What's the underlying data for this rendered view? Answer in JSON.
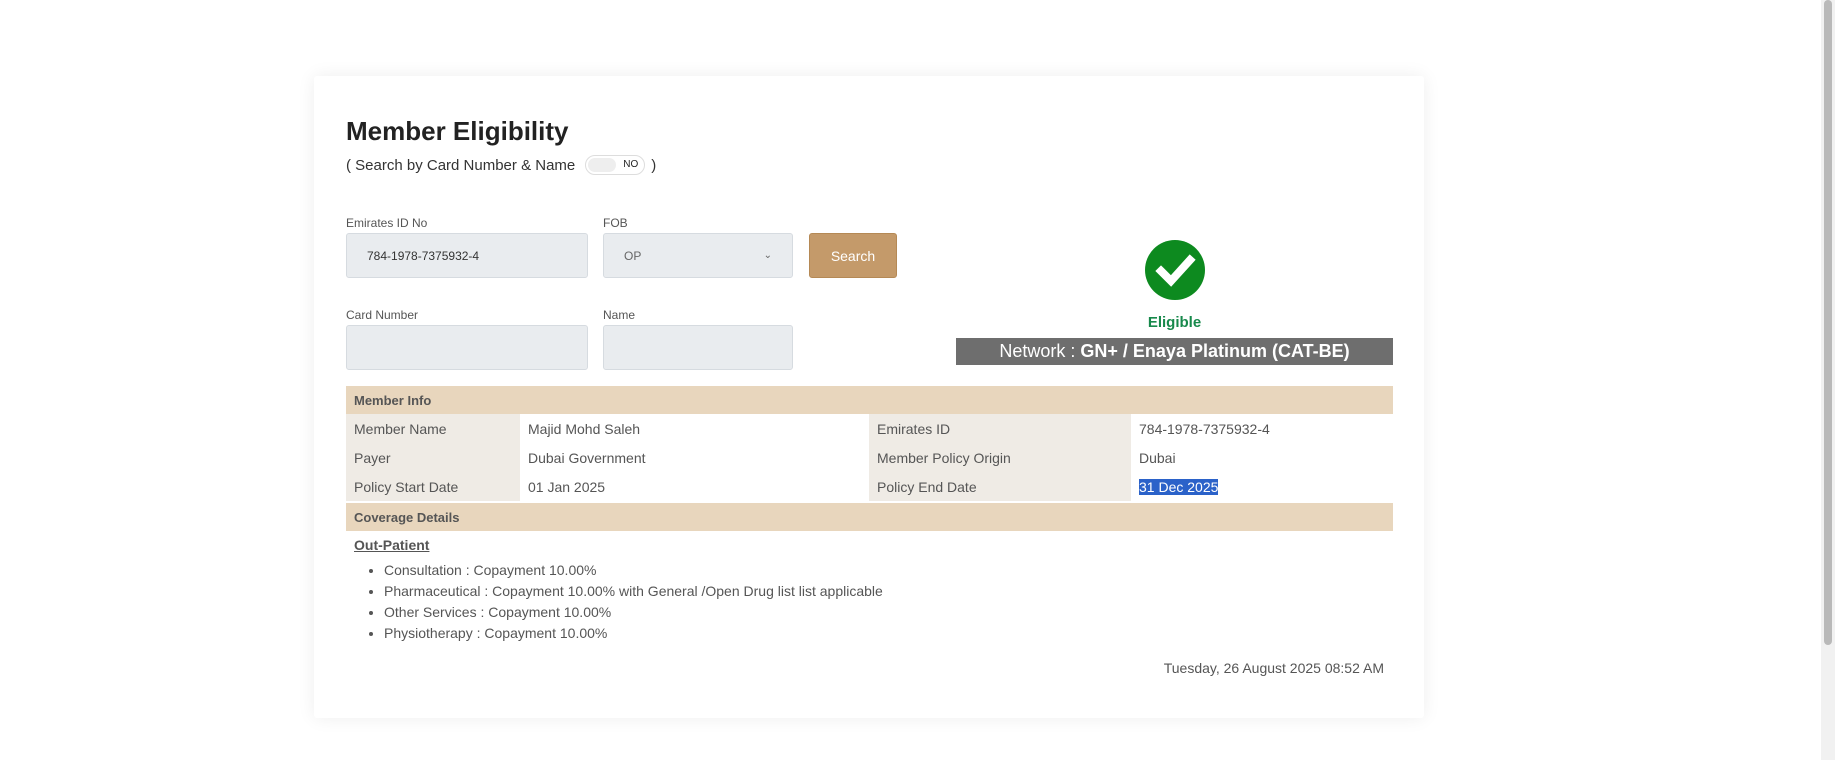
{
  "page": {
    "title": "Member Eligibility",
    "search_mode_prefix": "( Search by Card Number & Name",
    "search_mode_suffix": ")",
    "toggle_state": "NO"
  },
  "form": {
    "emirates_id": {
      "label": "Emirates ID No",
      "value": "784-1978-7375932-4"
    },
    "fob": {
      "label": "FOB",
      "selected": "OP"
    },
    "card_number": {
      "label": "Card Number",
      "value": ""
    },
    "name": {
      "label": "Name",
      "value": ""
    },
    "search_label": "Search"
  },
  "status": {
    "label": "Eligible",
    "network_prefix": "Network :",
    "network_value": "GN+ / Enaya Platinum (CAT-BE)"
  },
  "member_info": {
    "header": "Member Info",
    "rows": [
      {
        "l1": "Member Name",
        "v1": "Majid Mohd Saleh",
        "l2": "Emirates ID",
        "v2": "784-1978-7375932-4"
      },
      {
        "l1": "Payer",
        "v1": "Dubai Government",
        "l2": "Member Policy Origin",
        "v2": "Dubai"
      },
      {
        "l1": "Policy Start Date",
        "v1": "01 Jan 2025",
        "l2": "Policy End Date",
        "v2": "31 Dec 2025"
      }
    ]
  },
  "coverage": {
    "header": "Coverage Details",
    "section_title": "Out-Patient",
    "items": [
      "Consultation : Copayment 10.00%",
      "Pharmaceutical : Copayment 10.00% with General /Open Drug list list applicable",
      "Other Services : Copayment 10.00%",
      "Physiotherapy : Copayment 10.00%"
    ]
  },
  "footer": {
    "timestamp": "Tuesday, 26 August 2025 08:52 AM"
  },
  "colors": {
    "accent": "#c49a6a",
    "eligible": "#17894b",
    "section_header": "#e8d6bd",
    "network_bar": "#6e6e6e",
    "selection": "#2b62c9"
  },
  "icons": {
    "status": "check-circle-icon",
    "dropdown": "chevron-down-icon"
  }
}
